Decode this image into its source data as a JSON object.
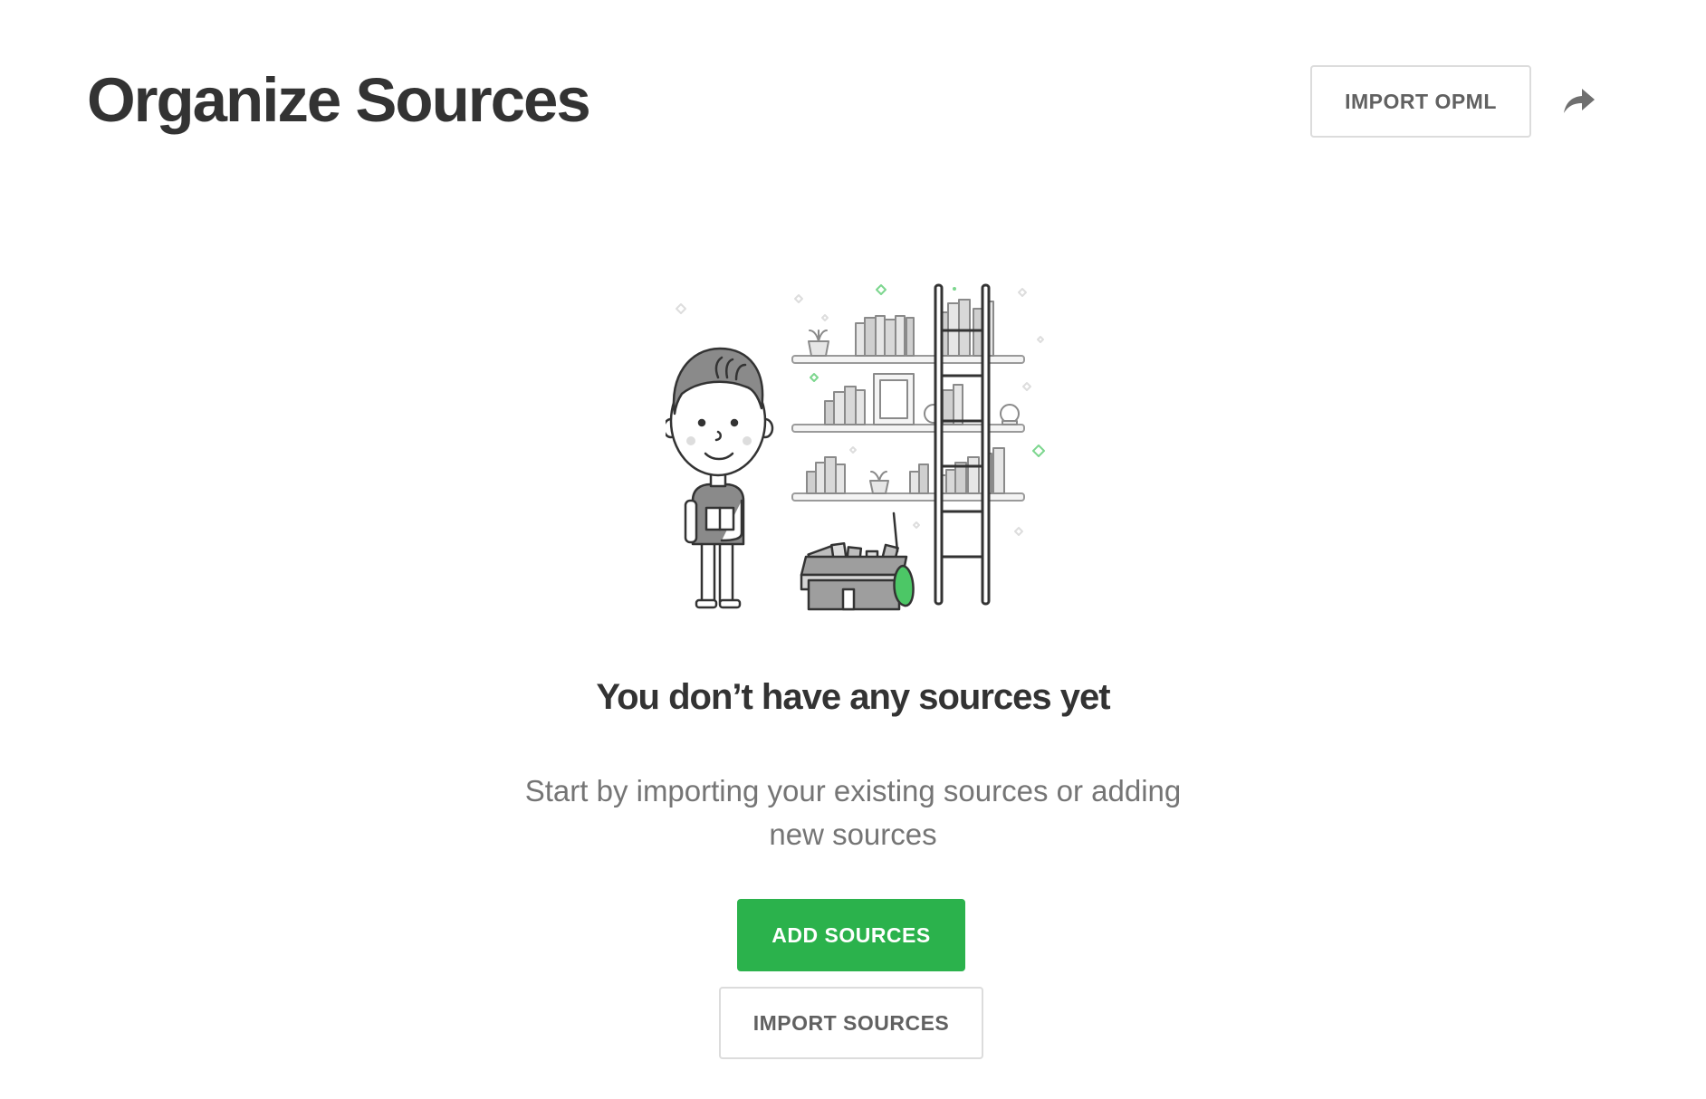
{
  "header": {
    "title": "Organize Sources",
    "import_opml_label": "IMPORT OPML",
    "share_icon": "share-arrow-icon"
  },
  "empty_state": {
    "illustration": "person-with-bookshelf-ladder-and-box",
    "title": "You don’t have any sources yet",
    "description": "Start by importing your existing sources or adding new sources",
    "add_sources_label": "ADD SOURCES",
    "import_sources_label": "IMPORT SOURCES"
  },
  "colors": {
    "primary": "#2bb24c",
    "text_dark": "#333333",
    "text_muted": "#757575",
    "border": "#dcdcdc"
  }
}
